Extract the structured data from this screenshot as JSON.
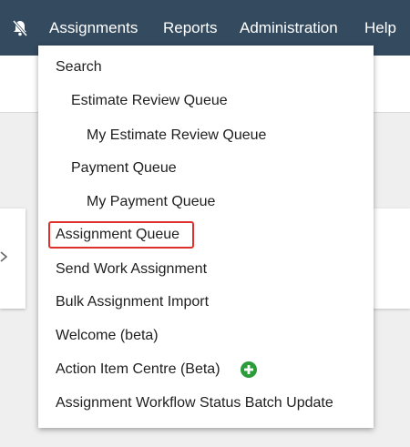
{
  "navbar": {
    "bell_icon": "bell-slash-icon",
    "items": [
      "Assignments",
      "Reports",
      "Administration",
      "Help"
    ],
    "background": "#344a5f"
  },
  "menu": {
    "items": [
      {
        "label": "Search"
      },
      {
        "label": "Estimate Review Queue"
      },
      {
        "label": "My Estimate Review Queue"
      },
      {
        "label": "Payment Queue"
      },
      {
        "label": "My Payment Queue"
      },
      {
        "label": "Assignment Queue",
        "highlighted": true
      },
      {
        "label": "Send Work Assignment"
      },
      {
        "label": "Bulk Assignment Import"
      },
      {
        "label": "Welcome (beta)"
      },
      {
        "label": "Action Item Centre (Beta)",
        "icon": "plus-circle-icon"
      },
      {
        "label": "Assignment Workflow Status Batch Update"
      }
    ],
    "highlight_color": "#e0302c",
    "plus_icon_color": "#2a9d3a"
  }
}
